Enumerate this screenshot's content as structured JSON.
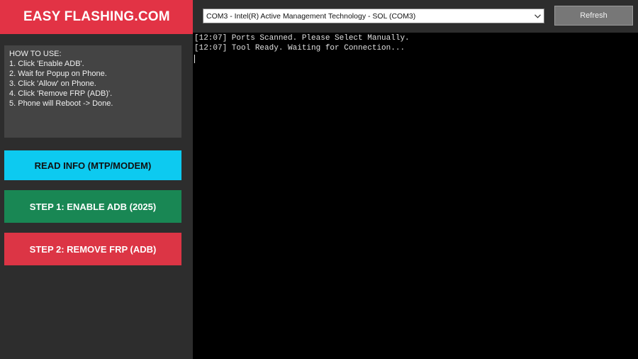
{
  "brand": {
    "title": "EASY FLASHING.COM"
  },
  "howto": {
    "lines": [
      "HOW TO USE:",
      "1. Click 'Enable ADB'.",
      "2. Wait for Popup on Phone.",
      "3. Click 'Allow' on Phone.",
      "4. Click 'Remove FRP (ADB)'.",
      "5. Phone will Reboot -> Done."
    ]
  },
  "buttons": {
    "read_info": "READ INFO (MTP/MODEM)",
    "step1": "STEP 1: ENABLE ADB (2025)",
    "step2": "STEP 2: REMOVE FRP (ADB)"
  },
  "toolbar": {
    "port_value": "COM3 - Intel(R) Active Management Technology - SOL (COM3)",
    "refresh_label": "Refresh"
  },
  "console": {
    "lines": [
      "[12:07] Ports Scanned. Please Select Manually.",
      "[12:07] Tool Ready. Waiting for Connection..."
    ]
  },
  "colors": {
    "brand": "#e23345",
    "read_info": "#0dcaf0",
    "step1": "#198754",
    "step2": "#dc3545"
  }
}
